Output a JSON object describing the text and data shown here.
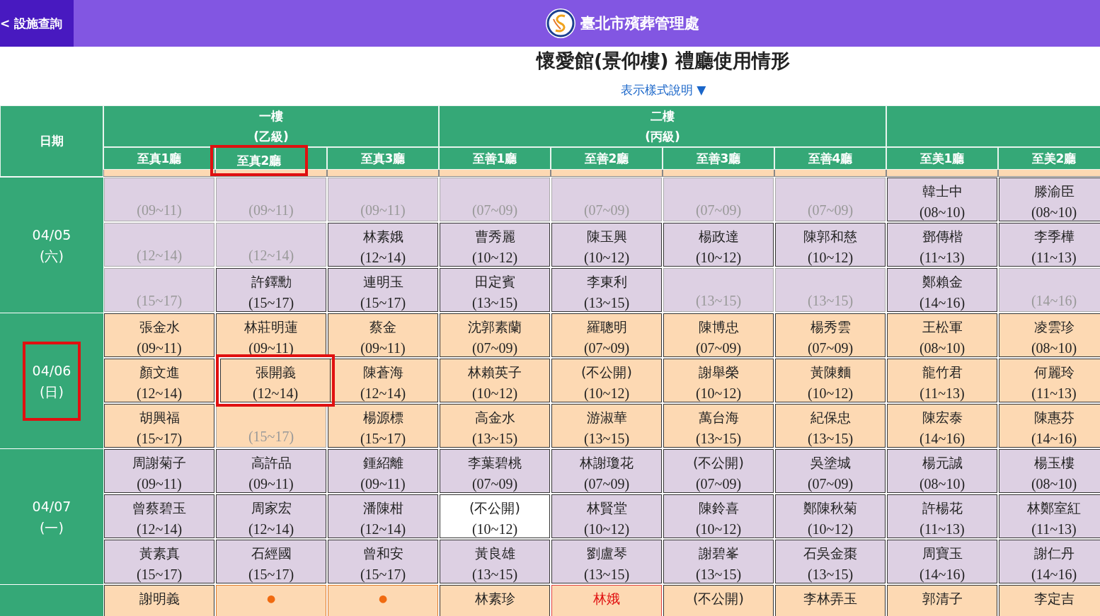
{
  "top_bar": {
    "back_button": "< 設施查詢",
    "agency": "臺北市殯葬管理處"
  },
  "title": "懷愛館(景仰樓) 禮廳使用情形",
  "legend_link": "表示樣式說明 ▼",
  "table": {
    "date_header": "日期",
    "groups": [
      {
        "name": "一樓",
        "grade": "(乙級)",
        "halls": [
          {
            "name": "至真1廳",
            "highlighted": false
          },
          {
            "name": "至真2廳",
            "highlighted": true
          },
          {
            "name": "至真3廳",
            "highlighted": false
          }
        ]
      },
      {
        "name": "二樓",
        "grade": "(丙級)",
        "halls": [
          {
            "name": "至善1廳",
            "highlighted": false
          },
          {
            "name": "至善2廳",
            "highlighted": false
          },
          {
            "name": "至善3廳",
            "highlighted": false
          },
          {
            "name": "至善4廳",
            "highlighted": false
          }
        ]
      },
      {
        "halls": [
          {
            "name": "至美1廳",
            "highlighted": false
          },
          {
            "name": "至美2廳",
            "highlighted": false
          }
        ]
      }
    ],
    "days": [
      {
        "date": "04/05",
        "weekday": "(六)",
        "highlighted": false,
        "color": "#ddd0e3",
        "slots": [
          [
            {
              "kind": "free",
              "time": "(09~11)"
            },
            {
              "kind": "free",
              "time": "(09~11)"
            },
            {
              "kind": "free",
              "time": "(09~11)"
            },
            {
              "kind": "free",
              "time": "(07~09)"
            },
            {
              "kind": "free",
              "time": "(07~09)"
            },
            {
              "kind": "free",
              "time": "(07~09)"
            },
            {
              "kind": "free",
              "time": "(07~09)"
            },
            {
              "kind": "booked",
              "name": "韓士中",
              "time": "(08~10)"
            },
            {
              "kind": "booked",
              "name": "滕渝臣",
              "time": "(08~10)"
            }
          ],
          [
            {
              "kind": "free",
              "time": "(12~14)"
            },
            {
              "kind": "free",
              "time": "(12~14)"
            },
            {
              "kind": "booked",
              "name": "林素娥",
              "time": "(12~14)"
            },
            {
              "kind": "booked",
              "name": "曹秀麗",
              "time": "(10~12)"
            },
            {
              "kind": "booked",
              "name": "陳玉興",
              "time": "(10~12)"
            },
            {
              "kind": "booked",
              "name": "楊政達",
              "time": "(10~12)"
            },
            {
              "kind": "booked",
              "name": "陳郭和慈",
              "time": "(10~12)"
            },
            {
              "kind": "booked",
              "name": "鄧傳楷",
              "time": "(11~13)"
            },
            {
              "kind": "booked",
              "name": "李季樺",
              "time": "(11~13)"
            }
          ],
          [
            {
              "kind": "free",
              "time": "(15~17)"
            },
            {
              "kind": "booked",
              "name": "許鐸勳",
              "time": "(15~17)"
            },
            {
              "kind": "booked",
              "name": "連明玉",
              "time": "(15~17)"
            },
            {
              "kind": "booked",
              "name": "田定賓",
              "time": "(13~15)"
            },
            {
              "kind": "booked",
              "name": "李東利",
              "time": "(13~15)"
            },
            {
              "kind": "free",
              "time": "(13~15)"
            },
            {
              "kind": "free",
              "time": "(13~15)"
            },
            {
              "kind": "booked",
              "name": "鄭賴金",
              "time": "(14~16)"
            },
            {
              "kind": "free",
              "time": "(14~16)"
            }
          ]
        ]
      },
      {
        "date": "04/06",
        "weekday": "(日)",
        "highlighted": true,
        "color": "#fdd9b3",
        "slots": [
          [
            {
              "kind": "booked",
              "name": "張金水",
              "time": "(09~11)"
            },
            {
              "kind": "booked",
              "name": "林莊明蓮",
              "time": "(09~11)"
            },
            {
              "kind": "booked",
              "name": "蔡金",
              "time": "(09~11)"
            },
            {
              "kind": "booked",
              "name": "沈郭素蘭",
              "time": "(07~09)"
            },
            {
              "kind": "booked",
              "name": "羅聰明",
              "time": "(07~09)"
            },
            {
              "kind": "booked",
              "name": "陳博忠",
              "time": "(07~09)"
            },
            {
              "kind": "booked",
              "name": "楊秀雲",
              "time": "(07~09)"
            },
            {
              "kind": "booked",
              "name": "王松軍",
              "time": "(08~10)"
            },
            {
              "kind": "booked",
              "name": "凌雲珍",
              "time": "(08~10)"
            }
          ],
          [
            {
              "kind": "booked",
              "name": "顏文進",
              "time": "(12~14)"
            },
            {
              "kind": "booked",
              "name": "張開義",
              "time": "(12~14)",
              "highlighted": true
            },
            {
              "kind": "booked",
              "name": "陳蒼海",
              "time": "(12~14)"
            },
            {
              "kind": "booked",
              "name": "林賴英子",
              "time": "(10~12)"
            },
            {
              "kind": "booked",
              "name": "(不公開)",
              "time": "(10~12)"
            },
            {
              "kind": "booked",
              "name": "謝舉榮",
              "time": "(10~12)"
            },
            {
              "kind": "booked",
              "name": "黃陳麵",
              "time": "(10~12)"
            },
            {
              "kind": "booked",
              "name": "龍竹君",
              "time": "(11~13)"
            },
            {
              "kind": "booked",
              "name": "何麗玲",
              "time": "(11~13)"
            }
          ],
          [
            {
              "kind": "booked",
              "name": "胡興福",
              "time": "(15~17)"
            },
            {
              "kind": "free",
              "time": "(15~17)"
            },
            {
              "kind": "booked",
              "name": "楊源標",
              "time": "(15~17)"
            },
            {
              "kind": "booked",
              "name": "高金水",
              "time": "(13~15)"
            },
            {
              "kind": "booked",
              "name": "游淑華",
              "time": "(13~15)"
            },
            {
              "kind": "booked",
              "name": "萬台海",
              "time": "(13~15)"
            },
            {
              "kind": "booked",
              "name": "紀保忠",
              "time": "(13~15)"
            },
            {
              "kind": "booked",
              "name": "陳宏泰",
              "time": "(14~16)"
            },
            {
              "kind": "booked",
              "name": "陳惠芬",
              "time": "(14~16)"
            }
          ]
        ]
      },
      {
        "date": "04/07",
        "weekday": "(一)",
        "highlighted": false,
        "color": "#ddd0e3",
        "slots": [
          [
            {
              "kind": "booked",
              "name": "周謝菊子",
              "time": "(09~11)"
            },
            {
              "kind": "booked",
              "name": "高許品",
              "time": "(09~11)"
            },
            {
              "kind": "booked",
              "name": "鍾紹離",
              "time": "(09~11)"
            },
            {
              "kind": "booked",
              "name": "李葉碧桃",
              "time": "(07~09)"
            },
            {
              "kind": "booked",
              "name": "林謝瓊花",
              "time": "(07~09)"
            },
            {
              "kind": "booked",
              "name": "(不公開)",
              "time": "(07~09)"
            },
            {
              "kind": "booked",
              "name": "吳塗城",
              "time": "(07~09)"
            },
            {
              "kind": "booked",
              "name": "楊元誠",
              "time": "(08~10)"
            },
            {
              "kind": "booked",
              "name": "楊玉樓",
              "time": "(08~10)"
            }
          ],
          [
            {
              "kind": "booked",
              "name": "曾蔡碧玉",
              "time": "(12~14)"
            },
            {
              "kind": "booked",
              "name": "周家宏",
              "time": "(12~14)"
            },
            {
              "kind": "booked",
              "name": "潘陳柑",
              "time": "(12~14)"
            },
            {
              "kind": "private",
              "name": "(不公開)",
              "time": "(10~12)"
            },
            {
              "kind": "booked",
              "name": "林賢堂",
              "time": "(10~12)"
            },
            {
              "kind": "booked",
              "name": "陳鈴喜",
              "time": "(10~12)"
            },
            {
              "kind": "booked",
              "name": "鄭陳秋菊",
              "time": "(10~12)"
            },
            {
              "kind": "booked",
              "name": "許楊花",
              "time": "(11~13)"
            },
            {
              "kind": "booked",
              "name": "林鄭室紅",
              "time": "(11~13)"
            }
          ],
          [
            {
              "kind": "booked",
              "name": "黃素真",
              "time": "(15~17)"
            },
            {
              "kind": "booked",
              "name": "石經國",
              "time": "(15~17)"
            },
            {
              "kind": "booked",
              "name": "曾和安",
              "time": "(15~17)"
            },
            {
              "kind": "booked",
              "name": "黃良雄",
              "time": "(13~15)"
            },
            {
              "kind": "booked",
              "name": "劉盧琴",
              "time": "(13~15)"
            },
            {
              "kind": "booked",
              "name": "謝碧峯",
              "time": "(13~15)"
            },
            {
              "kind": "booked",
              "name": "石吳金棗",
              "time": "(13~15)"
            },
            {
              "kind": "booked",
              "name": "周寶玉",
              "time": "(14~16)"
            },
            {
              "kind": "booked",
              "name": "謝仁丹",
              "time": "(14~16)"
            }
          ]
        ]
      },
      {
        "highlighted": false,
        "color": "#fdd9b3",
        "slots": [
          [
            {
              "kind": "booked",
              "name": "謝明義"
            },
            {
              "kind": "pending",
              "name": "●"
            },
            {
              "kind": "pending",
              "name": "●"
            },
            {
              "kind": "booked",
              "name": "林素珍"
            },
            {
              "kind": "alert",
              "name": "林娥"
            },
            {
              "kind": "booked",
              "name": "(不公開)"
            },
            {
              "kind": "booked",
              "name": "李林弄玉"
            },
            {
              "kind": "booked",
              "name": "郭清子"
            },
            {
              "kind": "booked",
              "name": "李定吉"
            }
          ]
        ]
      }
    ]
  }
}
